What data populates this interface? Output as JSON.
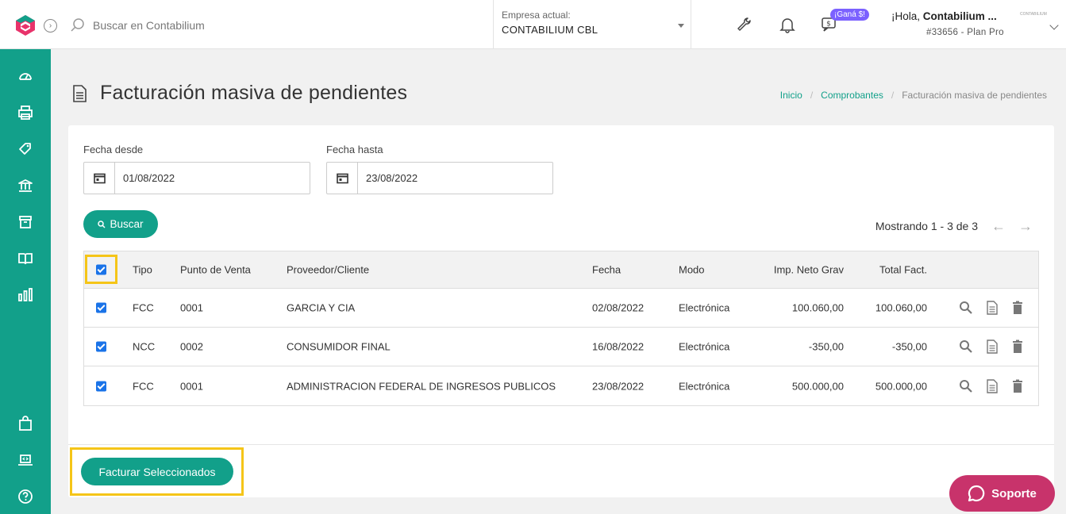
{
  "header": {
    "search_placeholder": "Buscar en Contabilium",
    "company_label": "Empresa actual:",
    "company_value": "CONTABILIUM CBL",
    "badge": "¡Ganá $!",
    "greeting_prefix": "¡Hola, ",
    "user_name": "Contabilium ...",
    "plan": "#33656 - Plan Pro",
    "brand_mini": "CONTABILIUM"
  },
  "page": {
    "title": "Facturación masiva de pendientes",
    "breadcrumb": [
      "Inicio",
      "Comprobantes",
      "Facturación masiva de pendientes"
    ]
  },
  "filters": {
    "from_label": "Fecha desde",
    "from_value": "01/08/2022",
    "to_label": "Fecha hasta",
    "to_value": "23/08/2022",
    "search_button": "Buscar"
  },
  "pager": {
    "text": "Mostrando 1 - 3 de 3"
  },
  "table": {
    "headers": [
      "Tipo",
      "Punto de Venta",
      "Proveedor/Cliente",
      "Fecha",
      "Modo",
      "Imp. Neto Grav",
      "Total Fact."
    ],
    "rows": [
      {
        "tipo": "FCC",
        "pv": "0001",
        "cliente": "GARCIA Y CIA",
        "fecha": "02/08/2022",
        "modo": "Electrónica",
        "neto": "100.060,00",
        "total": "100.060,00",
        "checked": true
      },
      {
        "tipo": "NCC",
        "pv": "0002",
        "cliente": "CONSUMIDOR FINAL",
        "fecha": "16/08/2022",
        "modo": "Electrónica",
        "neto": "-350,00",
        "total": "-350,00",
        "checked": true
      },
      {
        "tipo": "FCC",
        "pv": "0001",
        "cliente": "ADMINISTRACION FEDERAL DE INGRESOS PUBLICOS",
        "fecha": "23/08/2022",
        "modo": "Electrónica",
        "neto": "500.000,00",
        "total": "500.000,00",
        "checked": true
      }
    ]
  },
  "footer": {
    "facturar_button": "Facturar Seleccionados"
  },
  "support": {
    "label": "Soporte"
  },
  "colors": {
    "primary": "#12a08a",
    "highlight": "#f5c518",
    "support": "#c8336b",
    "badge": "#7b61ff"
  },
  "icons": {
    "sidebar_top": [
      "dashboard-icon",
      "printer-icon",
      "tag-icon",
      "bank-icon",
      "box-icon",
      "book-icon",
      "bar-chart-icon"
    ],
    "sidebar_bottom": [
      "shopping-bag-icon",
      "laptop-code-icon",
      "help-icon"
    ]
  }
}
